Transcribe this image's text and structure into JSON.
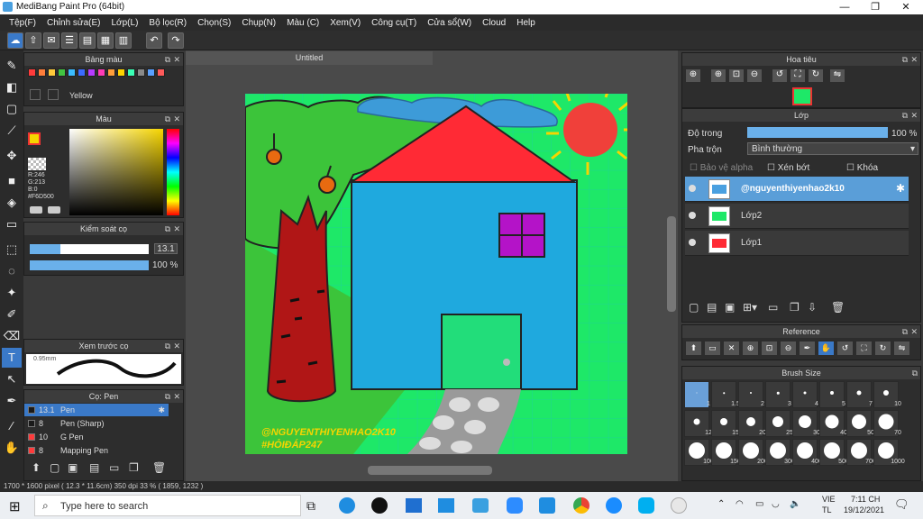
{
  "app": {
    "title": "MediBang Paint Pro (64bit)"
  },
  "menu": [
    "Tệp(F)",
    "Chỉnh sửa(E)",
    "Lớp(L)",
    "Bộ lọc(R)",
    "Chọn(S)",
    "Chụp(N)",
    "Màu (C)",
    "Xem(V)",
    "Công cụ(T)",
    "Cửa sổ(W)",
    "Cloud",
    "Help"
  ],
  "panels": {
    "palette": {
      "title": "Bảng màu",
      "selected_name": "Yellow",
      "swatches": [
        "#ff3b3b",
        "#ff7e3b",
        "#ffc93b",
        "#42c442",
        "#3bbcff",
        "#3b6bff",
        "#b63bff",
        "#ff3bb6",
        "#ff9e3b",
        "#ffd400",
        "#3bffb6",
        "#8a8a8a",
        "#5aa0ff",
        "#ff5a5a"
      ]
    },
    "color": {
      "title": "Màu",
      "r": "R:246",
      "g": "G:213",
      "b": "B:0",
      "hex": "#F6D500",
      "primary": "#F6D500"
    },
    "brush_control": {
      "title": "Kiểm soát cọ",
      "size": "13.1",
      "opacity": "100 %"
    },
    "preview": {
      "title": "Xem trước cọ",
      "size_label": "0.95mm"
    },
    "brush_list": {
      "title": "Cọ: Pen",
      "items": [
        {
          "size": "13.1",
          "name": "Pen",
          "color": "#1a1a1a",
          "selected": true
        },
        {
          "size": "8",
          "name": "Pen (Sharp)",
          "color": "#1a1a1a",
          "selected": false
        },
        {
          "size": "10",
          "name": "G Pen",
          "color": "#ff3b3b",
          "selected": false
        },
        {
          "size": "8",
          "name": "Mapping Pen",
          "color": "#ff3b3b",
          "selected": false
        }
      ]
    },
    "navigator": {
      "title": "Hoa tiêu"
    },
    "layer": {
      "title": "Lớp",
      "opacity_label": "Độ trong",
      "opacity": "100 %",
      "blend_label": "Pha trộn",
      "blend": "Bình thường",
      "protect_alpha": "Bảo vệ alpha",
      "clipping": "Xén bớt",
      "lock": "Khóa",
      "layers": [
        {
          "name": "@nguyenthiyenhao2k10",
          "selected": true
        },
        {
          "name": "Lớp2",
          "selected": false
        },
        {
          "name": "Lớp1",
          "selected": false
        }
      ]
    },
    "reference": {
      "title": "Reference"
    },
    "brush_size": {
      "title": "Brush Size",
      "sizes": [
        "1",
        "1.5",
        "2",
        "3",
        "4",
        "5",
        "7",
        "10",
        "12",
        "15",
        "20",
        "25",
        "30",
        "40",
        "50",
        "70",
        "100",
        "150",
        "200",
        "300",
        "400",
        "500",
        "700",
        "1000"
      ]
    }
  },
  "canvas": {
    "doc_tab": "Untitled",
    "signature_line1": "@NGUYENTHIYENHAO2K10",
    "signature_line2": "#HỎIĐÁP247"
  },
  "status": {
    "text": "1700 * 1600 pixel  ( 12.3 * 11.6cm)  350 dpi  33 %  ( 1859, 1232 )"
  },
  "taskbar": {
    "search_placeholder": "Type here to search",
    "lang1": "VIE",
    "lang2": "TL",
    "time": "7:11 CH",
    "date": "19/12/2021"
  }
}
